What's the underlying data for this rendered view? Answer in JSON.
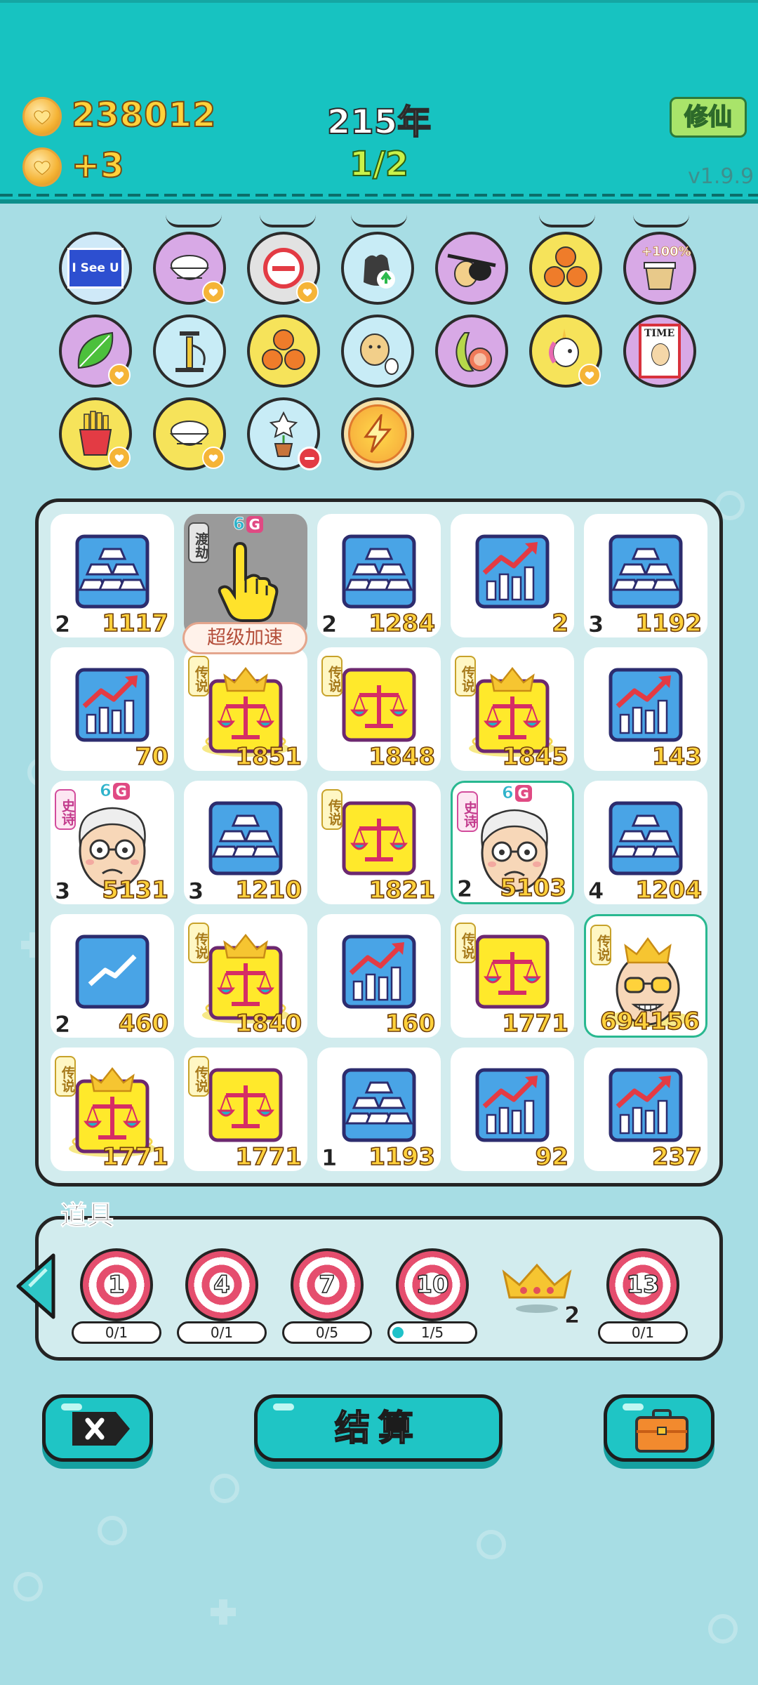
{
  "header": {
    "coins": "238012",
    "coin_rate": "+3",
    "year": "215年",
    "stage": "1/2",
    "cultivate_button": "修仙",
    "version": "v1.9.9"
  },
  "buffs": {
    "i_see_u_label": "I See U",
    "percent_label": "+100%",
    "time_label": "TIME"
  },
  "board": {
    "tiles": [
      {
        "level": "2",
        "value": "1117"
      },
      {
        "value": ""
      },
      {
        "level": "2",
        "value": "1284"
      },
      {
        "level": "",
        "value": "2"
      },
      {
        "level": "3",
        "value": "1192"
      },
      {
        "level": "",
        "value": "70"
      },
      {
        "level": "",
        "value": "1851",
        "tag": "传说"
      },
      {
        "level": "",
        "value": "1848",
        "tag": "传说"
      },
      {
        "level": "",
        "value": "1845",
        "tag": "传说"
      },
      {
        "level": "",
        "value": "143"
      },
      {
        "level": "3",
        "value": "5131",
        "tag": "史诗"
      },
      {
        "level": "3",
        "value": "1210"
      },
      {
        "level": "",
        "value": "1821",
        "tag": "传说"
      },
      {
        "level": "2",
        "value": "5103",
        "tag": "史诗"
      },
      {
        "level": "4",
        "value": "1204"
      },
      {
        "level": "2",
        "value": "460"
      },
      {
        "level": "",
        "value": "1840",
        "tag": "传说"
      },
      {
        "level": "",
        "value": "160"
      },
      {
        "level": "",
        "value": "1771",
        "tag": "传说"
      },
      {
        "level": "",
        "value": "694156",
        "tag": "传说"
      },
      {
        "level": "",
        "value": "1771",
        "tag": "传说"
      },
      {
        "level": "",
        "value": "1771",
        "tag": "传说"
      },
      {
        "level": "1",
        "value": "1193"
      },
      {
        "level": "",
        "value": "92"
      },
      {
        "level": "",
        "value": "237"
      }
    ],
    "dujie_tag": "渡劫",
    "speed_label": "超级加速",
    "g6_number": "6",
    "g6_letter": "G"
  },
  "items": {
    "title": "道具",
    "targets": [
      {
        "number": "1",
        "progress": "0/1"
      },
      {
        "number": "4",
        "progress": "0/1"
      },
      {
        "number": "7",
        "progress": "0/5"
      },
      {
        "number": "10",
        "progress": "1/5"
      },
      {
        "number": "13",
        "progress": "0/1"
      }
    ],
    "crown_count": "2"
  },
  "footer": {
    "settle_label": "结算"
  },
  "colors": {
    "header_bg": "#17c3c1",
    "page_bg": "#a7dde4",
    "coin_text": "#ffd23b",
    "stage_text": "#c9f24a",
    "button_bg": "#1fc5c5"
  }
}
